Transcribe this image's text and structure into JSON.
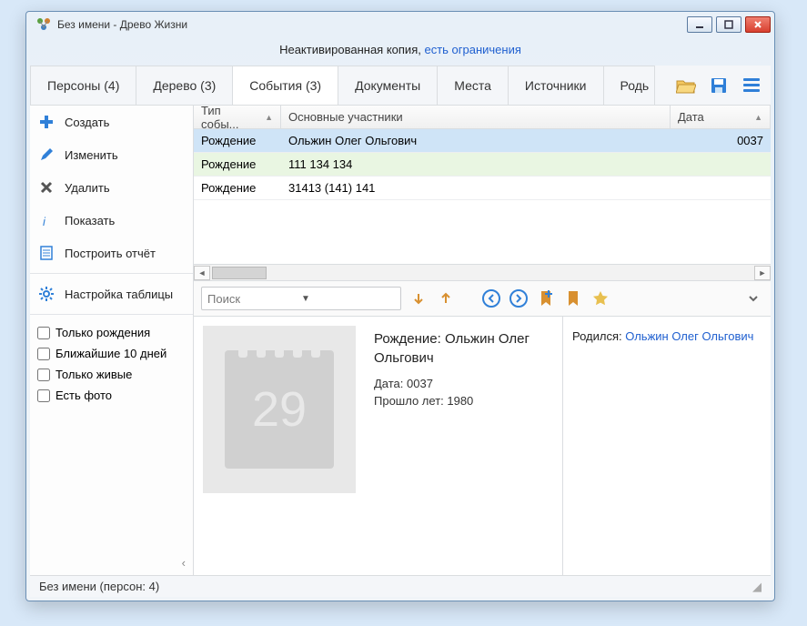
{
  "window": {
    "title": "Без имени - Древо Жизни"
  },
  "notice": {
    "text": "Неактивированная копия, ",
    "link": "есть ограничения"
  },
  "tabs": [
    {
      "label": "Персоны (4)"
    },
    {
      "label": "Дерево (3)"
    },
    {
      "label": "События (3)"
    },
    {
      "label": "Документы"
    },
    {
      "label": "Места"
    },
    {
      "label": "Источники"
    },
    {
      "label": "Родь"
    }
  ],
  "sidebar": {
    "create": "Создать",
    "edit": "Изменить",
    "delete": "Удалить",
    "show": "Показать",
    "report": "Построить отчёт",
    "settings": "Настройка таблицы"
  },
  "filters": {
    "only_births": "Только рождения",
    "next_10_days": "Ближайшие 10 дней",
    "only_alive": "Только живые",
    "has_photo": "Есть фото"
  },
  "table": {
    "headers": {
      "type": "Тип собы...",
      "participants": "Основные участники",
      "date": "Дата"
    },
    "rows": [
      {
        "type": "Рождение",
        "participants": "Ольжин Олег Ольгович",
        "date": "0037"
      },
      {
        "type": "Рождение",
        "participants": "111 134 134",
        "date": ""
      },
      {
        "type": "Рождение",
        "participants": "31413 (141) 141",
        "date": ""
      }
    ]
  },
  "search": {
    "placeholder": "Поиск"
  },
  "detail": {
    "calendar_num": "29",
    "title": "Рождение: Ольжин Олег Ольгович",
    "date_line": "Дата: 0037",
    "elapsed_line": "Прошло лет: 1980",
    "born_label": "Родился: ",
    "born_link": "Ольжин Олег Ольгович"
  },
  "status": {
    "text": "Без имени (персон: 4)"
  }
}
